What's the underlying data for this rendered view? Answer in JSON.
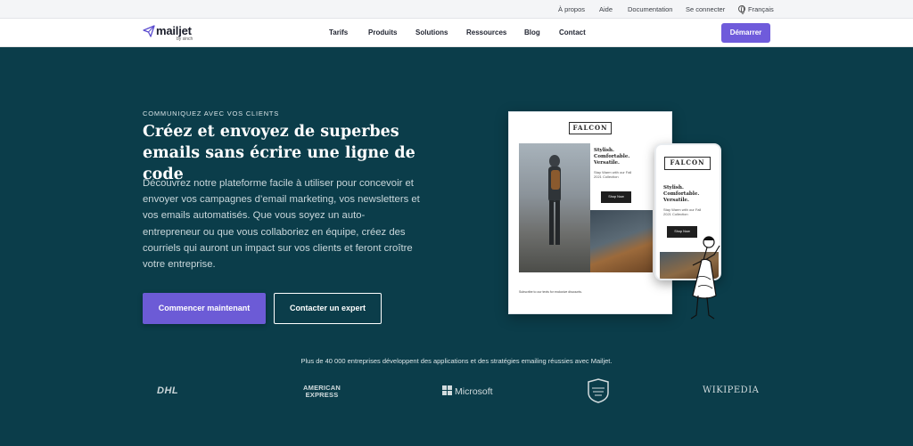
{
  "utility_nav": {
    "about": "À propos",
    "help": "Aide",
    "docs": "Documentation",
    "login": "Se connecter",
    "language": "Français"
  },
  "main_nav": {
    "logo_text": "mailjet",
    "logo_sub": "by sinch",
    "items": [
      "Tarifs",
      "Produits",
      "Solutions",
      "Ressources",
      "Blog",
      "Contact"
    ],
    "cta": "Démarrer"
  },
  "hero": {
    "eyebrow": "COMMUNIQUEZ AVEC VOS CLIENTS",
    "headline": "Créez et envoyez de superbes emails sans écrire une ligne de code",
    "description": "Découvrez notre plateforme facile à utiliser pour concevoir et envoyer vos campagnes d’email marketing, vos newsletters et vos emails automatisés. Que vous soyez un auto-entrepreneur ou que vous collaboriez en équipe, créez des courriels qui auront un impact sur vos clients et feront croître votre entreprise.",
    "primary_button": "Commencer maintenant",
    "secondary_button": "Contacter un expert"
  },
  "illustration": {
    "brand": "FALCON",
    "tagline_line1": "Stylish.",
    "tagline_line2": "Comfortable.",
    "tagline_line3": "Versatile.",
    "subcopy": "Stay Warm with our Fall 2021 Collection",
    "shop": "Shop Now",
    "footer": "Subscribe to our texts for exclusive discounts."
  },
  "trust": {
    "text": "Plus de 40 000 entreprises développent des applications et des stratégies emailing réussies avec Mailjet.",
    "logos": {
      "dhl": "DHL",
      "amex_line1": "AMERICAN",
      "amex_line2": "EXPRESS",
      "microsoft": "Microsoft",
      "wikipedia": "Wikipedia"
    }
  },
  "colors": {
    "background": "#0b3d4a",
    "accent": "#6c5bd6"
  }
}
